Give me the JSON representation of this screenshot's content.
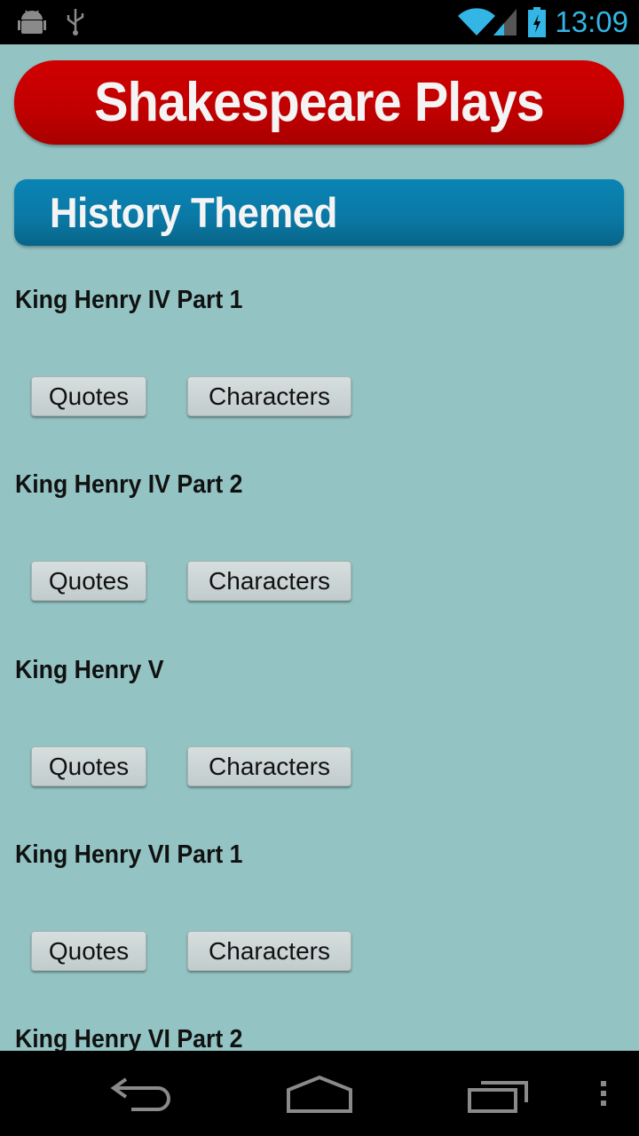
{
  "status_bar": {
    "time": "13:09",
    "icons": [
      "android-debug-icon",
      "usb-icon",
      "wifi-icon",
      "cell-signal-icon",
      "battery-charging-icon"
    ],
    "accent_color": "#33b5e5"
  },
  "header": {
    "title": "Shakespeare Plays",
    "color": "#c80000"
  },
  "section": {
    "title": "History Themed",
    "color": "#0a7eaa"
  },
  "buttons": {
    "quotes": "Quotes",
    "characters": "Characters"
  },
  "plays": [
    {
      "title": "King Henry IV Part 1"
    },
    {
      "title": "King Henry IV Part 2"
    },
    {
      "title": "King Henry V"
    },
    {
      "title": "King Henry VI Part 1"
    },
    {
      "title": "King Henry VI Part 2"
    }
  ],
  "nav_bar": {
    "icons": [
      "back-icon",
      "home-icon",
      "recent-apps-icon",
      "overflow-menu-icon"
    ]
  }
}
